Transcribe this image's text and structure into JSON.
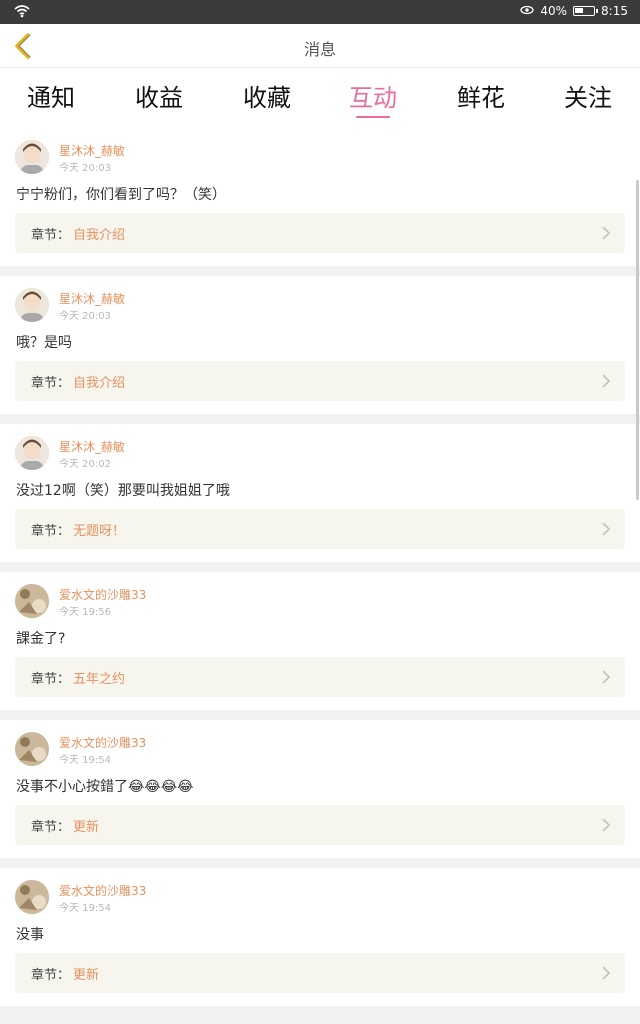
{
  "status_bar": {
    "battery": "40%",
    "time": "8:15"
  },
  "header": {
    "title": "消息"
  },
  "tabs": [
    {
      "label": "通知"
    },
    {
      "label": "收益"
    },
    {
      "label": "收藏"
    },
    {
      "label": "互动",
      "active": true
    },
    {
      "label": "鲜花"
    },
    {
      "label": "关注"
    }
  ],
  "chapter_prefix": "章节：",
  "messages": [
    {
      "user": "星沐沐_赫敏",
      "time": "今天 20:03",
      "text": "宁宁粉们，你们看到了吗？（笑）",
      "chapter": "自我介绍"
    },
    {
      "user": "星沐沐_赫敏",
      "time": "今天 20:03",
      "text": "哦？是吗",
      "chapter": "自我介绍"
    },
    {
      "user": "星沐沐_赫敏",
      "time": "今天 20:02",
      "text": "没过12啊（笑）那要叫我姐姐了哦",
      "chapter": "无题呀！"
    },
    {
      "user": "爱水文的沙雕33",
      "time": "今天 19:56",
      "text": "課金了?",
      "chapter": "五年之约"
    },
    {
      "user": "爱水文的沙雕33",
      "time": "今天 19:54",
      "text": "没事不小心按錯了😂😂😂😂",
      "chapter": "更新"
    },
    {
      "user": "爱水文的沙雕33",
      "time": "今天 19:54",
      "text": "没事",
      "chapter": "更新"
    }
  ],
  "colors": {
    "accent": "#e86d9a",
    "username": "#e9915f",
    "status_bar": "#3b3b3b"
  }
}
